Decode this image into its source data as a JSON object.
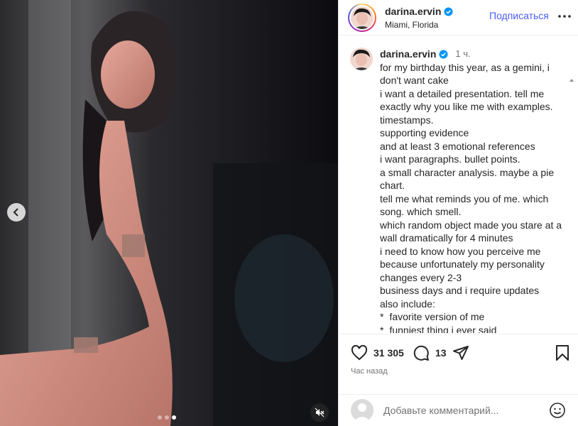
{
  "header": {
    "username": "darina.ervin",
    "location": "Miami, Florida",
    "follow_label": "Подписаться"
  },
  "caption": {
    "username": "darina.ervin",
    "time": "1 ч.",
    "lines": [
      "for my birthday this year, as a gemini, i don't want cake",
      "i want a detailed presentation. tell me exactly why you like me with examples.",
      "timestamps.",
      "supporting evidence",
      "and at least 3 emotional references",
      "i want paragraphs. bullet points.",
      "a small character analysis. maybe a pie chart.",
      "tell me what reminds you of me. which song. which smell.",
      "which random object made you stare at a wall dramatically for 4 minutes",
      "i need to know how you perceive me because unfortunately my personality changes every 2-3",
      "business days and i require updates",
      "also include:"
    ],
    "bullets": [
      "favorite version of me",
      "funniest thing i ever said"
    ]
  },
  "actions": {
    "likes": "31 305",
    "comments": "13",
    "posted": "Час назад"
  },
  "comment": {
    "placeholder": "Добавьте комментарий..."
  },
  "media": {
    "slide_index": 3,
    "slide_total": 3
  },
  "icons": {
    "verified": "verified-badge-icon",
    "like": "heart-icon",
    "comment": "comment-bubble-icon",
    "share": "paper-plane-icon",
    "save": "bookmark-icon",
    "more": "more-horizontal-icon",
    "prev": "chevron-left-icon",
    "mute": "speaker-muted-icon",
    "emoji": "smiley-icon"
  },
  "colors": {
    "follow": "#4a5df9",
    "verified": "#0095f6",
    "muted_text": "#737373"
  }
}
